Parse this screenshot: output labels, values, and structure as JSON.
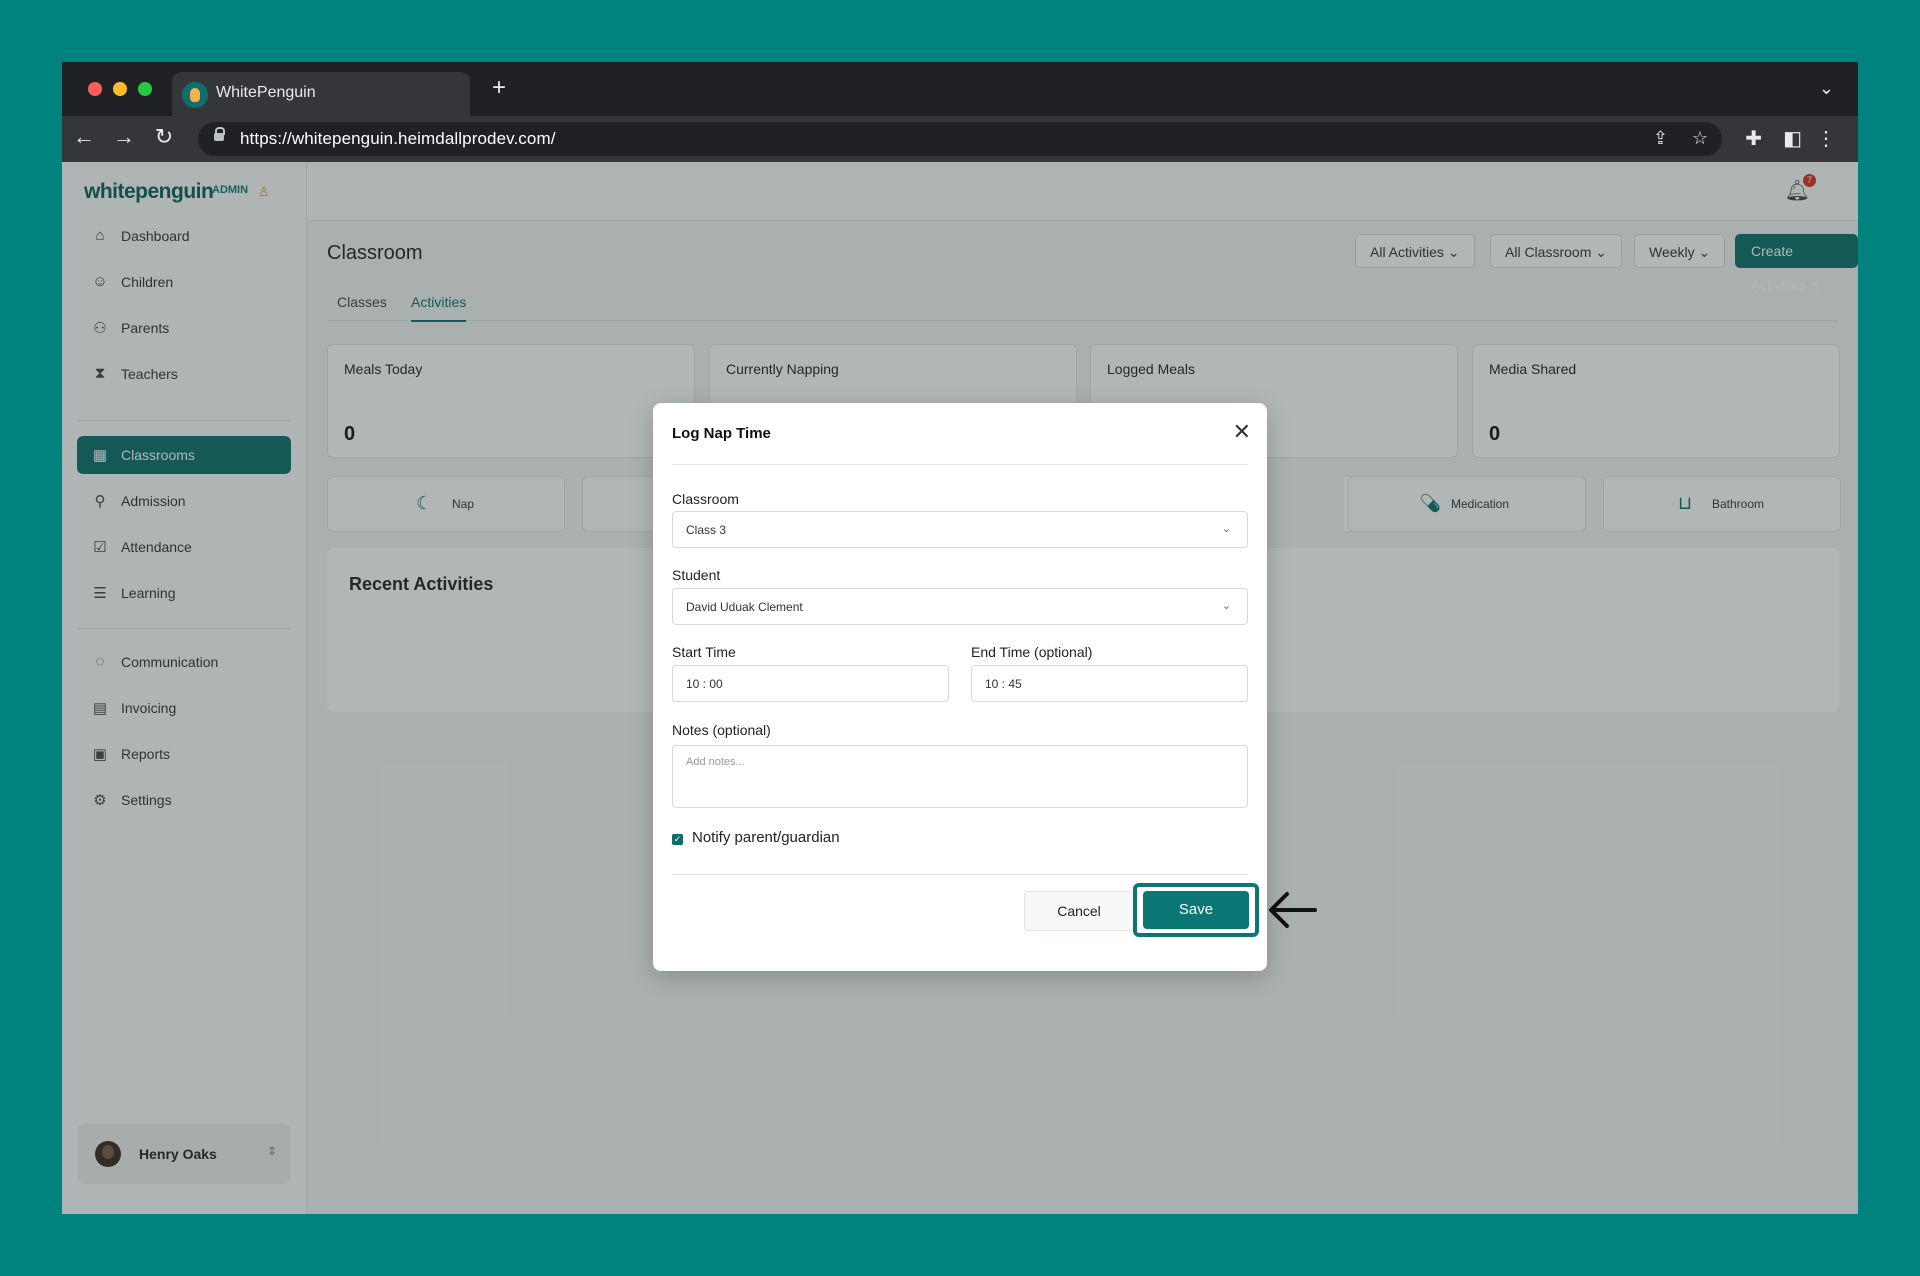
{
  "browser": {
    "tab_title": "WhitePenguin",
    "new_tab": "+",
    "url": "https://whitepenguin.heimdallprodev.com/"
  },
  "sidebar": {
    "logo": "whitepenguin",
    "admin_label": "ADMIN",
    "items_top": [
      {
        "label": "Dashboard",
        "icon": "home-icon"
      },
      {
        "label": "Children",
        "icon": "child-icon"
      },
      {
        "label": "Parents",
        "icon": "parents-icon"
      },
      {
        "label": "Teachers",
        "icon": "teacher-icon"
      }
    ],
    "items_mid": [
      {
        "label": "Classrooms",
        "icon": "classrooms-icon",
        "active": true
      },
      {
        "label": "Admission",
        "icon": "admission-icon"
      },
      {
        "label": "Attendance",
        "icon": "attendance-icon"
      },
      {
        "label": "Learning",
        "icon": "learning-icon"
      }
    ],
    "items_bottom": [
      {
        "label": "Communication",
        "icon": "chat-icon"
      },
      {
        "label": "Invoicing",
        "icon": "invoice-icon"
      },
      {
        "label": "Reports",
        "icon": "reports-icon"
      },
      {
        "label": "Settings",
        "icon": "settings-icon"
      }
    ],
    "user_name": "Henry Oaks"
  },
  "topbar": {
    "notification_count": "7"
  },
  "page": {
    "title": "Classroom",
    "filters": [
      "All Activities",
      "All Classroom",
      "Weekly"
    ],
    "create_button": "Create Activities",
    "tabs": [
      "Classes",
      "Activities"
    ],
    "active_tab": "Activities",
    "stats": [
      {
        "label": "Meals Today",
        "value": "0"
      },
      {
        "label": "Currently Napping",
        "value": ""
      },
      {
        "label": "Logged Meals",
        "value": ""
      },
      {
        "label": "Media Shared",
        "value": "0"
      }
    ],
    "activity_buttons": [
      {
        "label": "Nap",
        "icon": "nap-icon"
      },
      {
        "label": "Medication",
        "icon": "medication-icon"
      },
      {
        "label": "Bathroom",
        "icon": "bathroom-icon"
      }
    ],
    "recent_heading": "Recent Activities"
  },
  "modal": {
    "title": "Log Nap Time",
    "classroom_label": "Classroom",
    "classroom_value": "Class 3",
    "student_label": "Student",
    "student_value": "David Uduak Clement",
    "start_label": "Start Time",
    "start_value": "10 : 00",
    "end_label": "End Time (optional)",
    "end_value": "10 : 45",
    "notes_label": "Notes (optional)",
    "notes_placeholder": "Add notes...",
    "notify_label": "Notify parent/guardian",
    "notify_checked": true,
    "cancel_label": "Cancel",
    "save_label": "Save"
  },
  "colors": {
    "accent": "#0b6e6a",
    "frame": "#00827f"
  }
}
